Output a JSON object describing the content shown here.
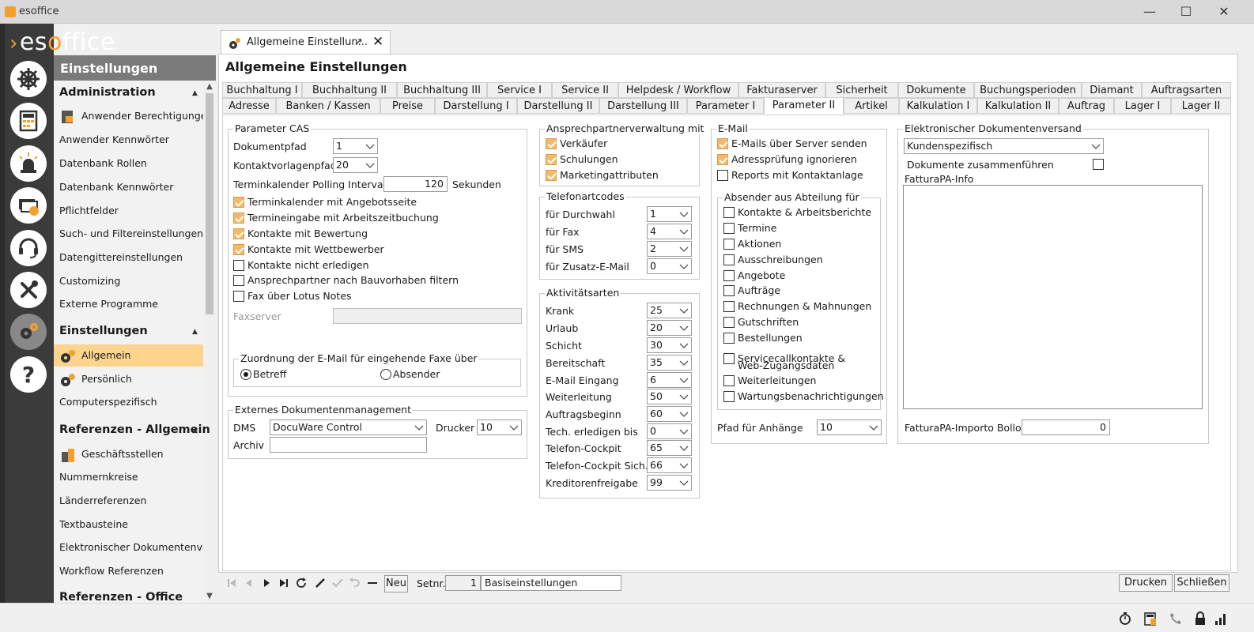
{
  "window": {
    "title": "esoffice",
    "minimize": "—",
    "maximize": "☐",
    "close": "✕"
  },
  "logo": {
    "a": "es",
    "b": "o",
    "c": "ffice"
  },
  "nav": {
    "header": "Einstellungen",
    "sections": [
      {
        "title": "Administration"
      },
      {
        "title": "Einstellungen"
      },
      {
        "title": "Referenzen - Allgemein"
      },
      {
        "title": "Referenzen - Office"
      }
    ],
    "items": [
      "Anwender Berechtigungen",
      "Anwender Kennwörter",
      "Datenbank Rollen",
      "Datenbank Kennwörter",
      "Pflichtfelder",
      "Such- und Filtereinstellungen",
      "Datengittereinstellungen",
      "Customizing",
      "Externe Programme",
      "Allgemein",
      "Persönlich",
      "Computerspezifisch",
      "Geschäftsstellen",
      "Nummernkreise",
      "Länderreferenzen",
      "Textbausteine",
      "Elektronischer Dokumentenvers...",
      "Workflow Referenzen"
    ]
  },
  "doctab": {
    "title": "Allgemeine Einstellun..."
  },
  "page": {
    "title": "Allgemeine Einstellungen"
  },
  "tabs": {
    "row1": [
      "Buchhaltung I",
      "Buchhaltung II",
      "Buchhaltung III",
      "Service I",
      "Service II",
      "Helpdesk / Workflow",
      "Fakturaserver",
      "Sicherheit",
      "Dokumente",
      "Buchungsperioden",
      "Diamant",
      "Auftragsarten"
    ],
    "row2": [
      "Adresse",
      "Banken / Kassen",
      "Preise",
      "Darstellung I",
      "Darstellung II",
      "Darstellung III",
      "Parameter I",
      "Parameter II",
      "Artikel",
      "Kalkulation I",
      "Kalkulation II",
      "Auftrag",
      "Lager I",
      "Lager II"
    ],
    "active": "Parameter II"
  },
  "cas": {
    "title": "Parameter CAS",
    "dokumentpfad_label": "Dokumentpfad",
    "dokumentpfad": "1",
    "kontaktvorlagenpfad_label": "Kontaktvorlagenpfad",
    "kontaktvorlagenpfad": "20",
    "polling_label": "Terminkalender Polling Intervall",
    "polling": "120",
    "polling_unit": "Sekunden",
    "checks": [
      {
        "label": "Terminkalender mit Angebotsseite",
        "checked": true
      },
      {
        "label": "Termineingabe mit Arbeitszeitbuchung",
        "checked": true
      },
      {
        "label": "Kontakte mit Bewertung",
        "checked": true
      },
      {
        "label": "Kontakte mit Wettbewerber",
        "checked": true
      },
      {
        "label": "Kontakte nicht erledigen",
        "checked": false
      },
      {
        "label": "Ansprechpartner nach Bauvorhaben filtern",
        "checked": false
      },
      {
        "label": "Fax über Lotus Notes",
        "checked": false
      }
    ],
    "faxserver_label": "Faxserver",
    "faxserver": "",
    "fax_group_title": "Zuordnung der E-Mail für eingehende Faxe über",
    "radio_betreff": "Betreff",
    "radio_absender": "Absender",
    "radio_selected": "Betreff"
  },
  "ext": {
    "title": "Externes Dokumentenmanagement",
    "dms_label": "DMS",
    "dms": "DocuWare Control",
    "drucker_label": "Drucker",
    "drucker": "10",
    "archiv_label": "Archiv",
    "archiv": ""
  },
  "ansp": {
    "title": "Ansprechpartnerverwaltung mit",
    "checks": [
      {
        "label": "Verkäufer",
        "checked": true
      },
      {
        "label": "Schulungen",
        "checked": true
      },
      {
        "label": "Marketingattributen",
        "checked": true
      }
    ]
  },
  "tel": {
    "title": "Telefonartcodes",
    "rows": [
      {
        "label": "für Durchwahl",
        "value": "1"
      },
      {
        "label": "für Fax",
        "value": "4"
      },
      {
        "label": "für SMS",
        "value": "2"
      },
      {
        "label": "für Zusatz-E-Mail",
        "value": "0"
      }
    ]
  },
  "akt": {
    "title": "Aktivitätsarten",
    "rows": [
      {
        "label": "Krank",
        "value": "25"
      },
      {
        "label": "Urlaub",
        "value": "20"
      },
      {
        "label": "Schicht",
        "value": "30"
      },
      {
        "label": "Bereitschaft",
        "value": "35"
      },
      {
        "label": "E-Mail Eingang",
        "value": "6"
      },
      {
        "label": "Weiterleitung",
        "value": "50"
      },
      {
        "label": "Auftragsbeginn",
        "value": "60"
      },
      {
        "label": "Tech. erledigen bis",
        "value": "0"
      },
      {
        "label": "Telefon-Cockpit",
        "value": "65"
      },
      {
        "label": "Telefon-Cockpit Sich.",
        "value": "66"
      },
      {
        "label": "Kreditorenfreigabe",
        "value": "99"
      }
    ]
  },
  "email": {
    "title": "E-Mail",
    "checks": [
      {
        "label": "E-Mails über Server senden",
        "checked": true
      },
      {
        "label": "Adressprüfung ignorieren",
        "checked": true
      },
      {
        "label": "Reports mit Kontaktanlage",
        "checked": false
      }
    ],
    "abs_title": "Absender aus Abteilung für",
    "abs": [
      {
        "label": "Kontakte & Arbeitsberichte",
        "checked": false
      },
      {
        "label": "Termine",
        "checked": false
      },
      {
        "label": "Aktionen",
        "checked": false
      },
      {
        "label": "Ausschreibungen",
        "checked": false
      },
      {
        "label": "Angebote",
        "checked": false
      },
      {
        "label": "Aufträge",
        "checked": false
      },
      {
        "label": "Rechnungen & Mahnungen",
        "checked": false
      },
      {
        "label": "Gutschriften",
        "checked": false
      },
      {
        "label": "Bestellungen",
        "checked": false
      },
      {
        "label": "Servicecallkontakte &",
        "label2": "Web-Zugangsdaten",
        "checked": false
      },
      {
        "label": "Weiterleitungen",
        "checked": false
      },
      {
        "label": "Wartungsbenachrichtigungen",
        "checked": false
      }
    ],
    "pfad_label": "Pfad für Anhänge",
    "pfad": "10"
  },
  "elek": {
    "title": "Elektronischer Dokumentenversand",
    "mode": "Kundenspezifisch",
    "merge_label": "Dokumente zusammenführen",
    "merge_checked": false,
    "fattura_info_label": "FatturaPA-Info",
    "bollo_label": "FatturaPA-Importo Bollo",
    "bollo": "0"
  },
  "navbar": {
    "neu": "Neu",
    "setnr_label": "Setnr.",
    "setnr": "1",
    "setname": "Basiseinstellungen",
    "drucken": "Drucken",
    "schliessen": "Schließen"
  },
  "colors": {
    "accent": "#f2a12e",
    "selection": "#fcd48e",
    "check": "#f6b96b",
    "rail": "#3b3b3b"
  }
}
